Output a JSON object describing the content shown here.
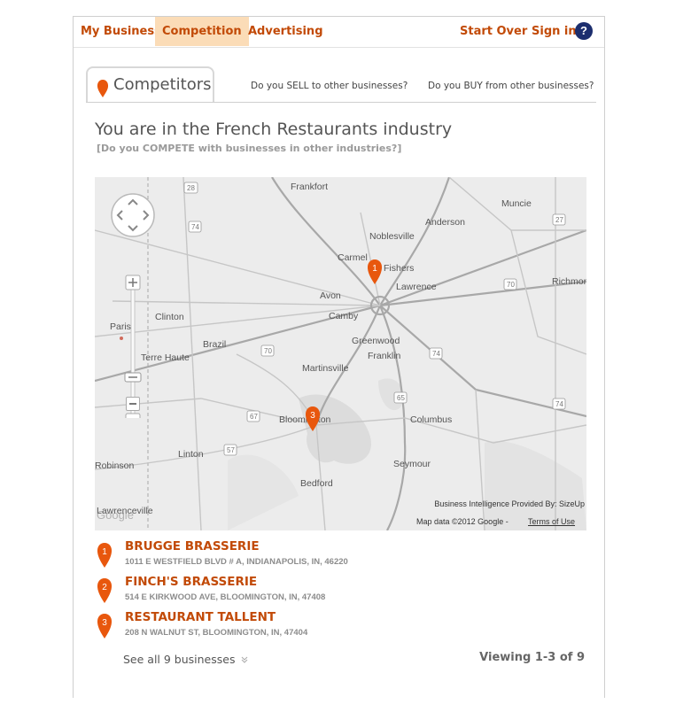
{
  "nav": {
    "my_business": "My Business",
    "competition": "Competition",
    "advertising": "Advertising",
    "start_over": "Start Over",
    "sign_in": "Sign in",
    "help": "?"
  },
  "tabs": {
    "active": "Competitors",
    "sell": "Do you SELL to other businesses?",
    "buy": "Do you BUY from other businesses?"
  },
  "industry": {
    "headline": "You are in the French Restaurants industry",
    "compete_link": "[Do you COMPETE with businesses in other industries?]"
  },
  "map": {
    "cities": [
      {
        "name": "Frankfort"
      },
      {
        "name": "Muncie"
      },
      {
        "name": "Anderson"
      },
      {
        "name": "Noblesville"
      },
      {
        "name": "Carmel"
      },
      {
        "name": "Fishers"
      },
      {
        "name": "Lawrence"
      },
      {
        "name": "Richmond"
      },
      {
        "name": "Avon"
      },
      {
        "name": "Camby"
      },
      {
        "name": "Clinton"
      },
      {
        "name": "Paris"
      },
      {
        "name": "Brazil"
      },
      {
        "name": "Terre Haute"
      },
      {
        "name": "Greenwood"
      },
      {
        "name": "Franklin"
      },
      {
        "name": "Martinsville"
      },
      {
        "name": "Bloomington"
      },
      {
        "name": "Columbus"
      },
      {
        "name": "Linton"
      },
      {
        "name": "Robinson"
      },
      {
        "name": "Seymour"
      },
      {
        "name": "Bedford"
      },
      {
        "name": "Lawrenceville"
      }
    ],
    "roads": [
      "28",
      "74",
      "27",
      "70",
      "70",
      "74",
      "74",
      "65",
      "67",
      "57"
    ],
    "attribution": "Business Intelligence Provided By: SizeUp",
    "map_data": "Map data ©2012 Google -",
    "terms": "Terms of Use",
    "logo": "Google",
    "markers": [
      "1",
      "3"
    ]
  },
  "results": [
    {
      "num": "1",
      "name": "BRUGGE BRASSERIE",
      "address": "1011 E WESTFIELD BLVD # A, INDIANAPOLIS, IN, 46220"
    },
    {
      "num": "2",
      "name": "FINCH'S BRASSERIE",
      "address": "514 E KIRKWOOD AVE, BLOOMINGTON, IN, 47408"
    },
    {
      "num": "3",
      "name": "RESTAURANT TALLENT",
      "address": "208 N WALNUT ST, BLOOMINGTON, IN, 47404"
    }
  ],
  "footer": {
    "see_all": "See all 9 businesses",
    "viewing": "Viewing 1-3 of 9"
  },
  "colors": {
    "accent": "#c24a07",
    "active_tab_bg": "#fbdcb7",
    "marker": "#e8570d",
    "help_bg": "#1c2e6e"
  }
}
